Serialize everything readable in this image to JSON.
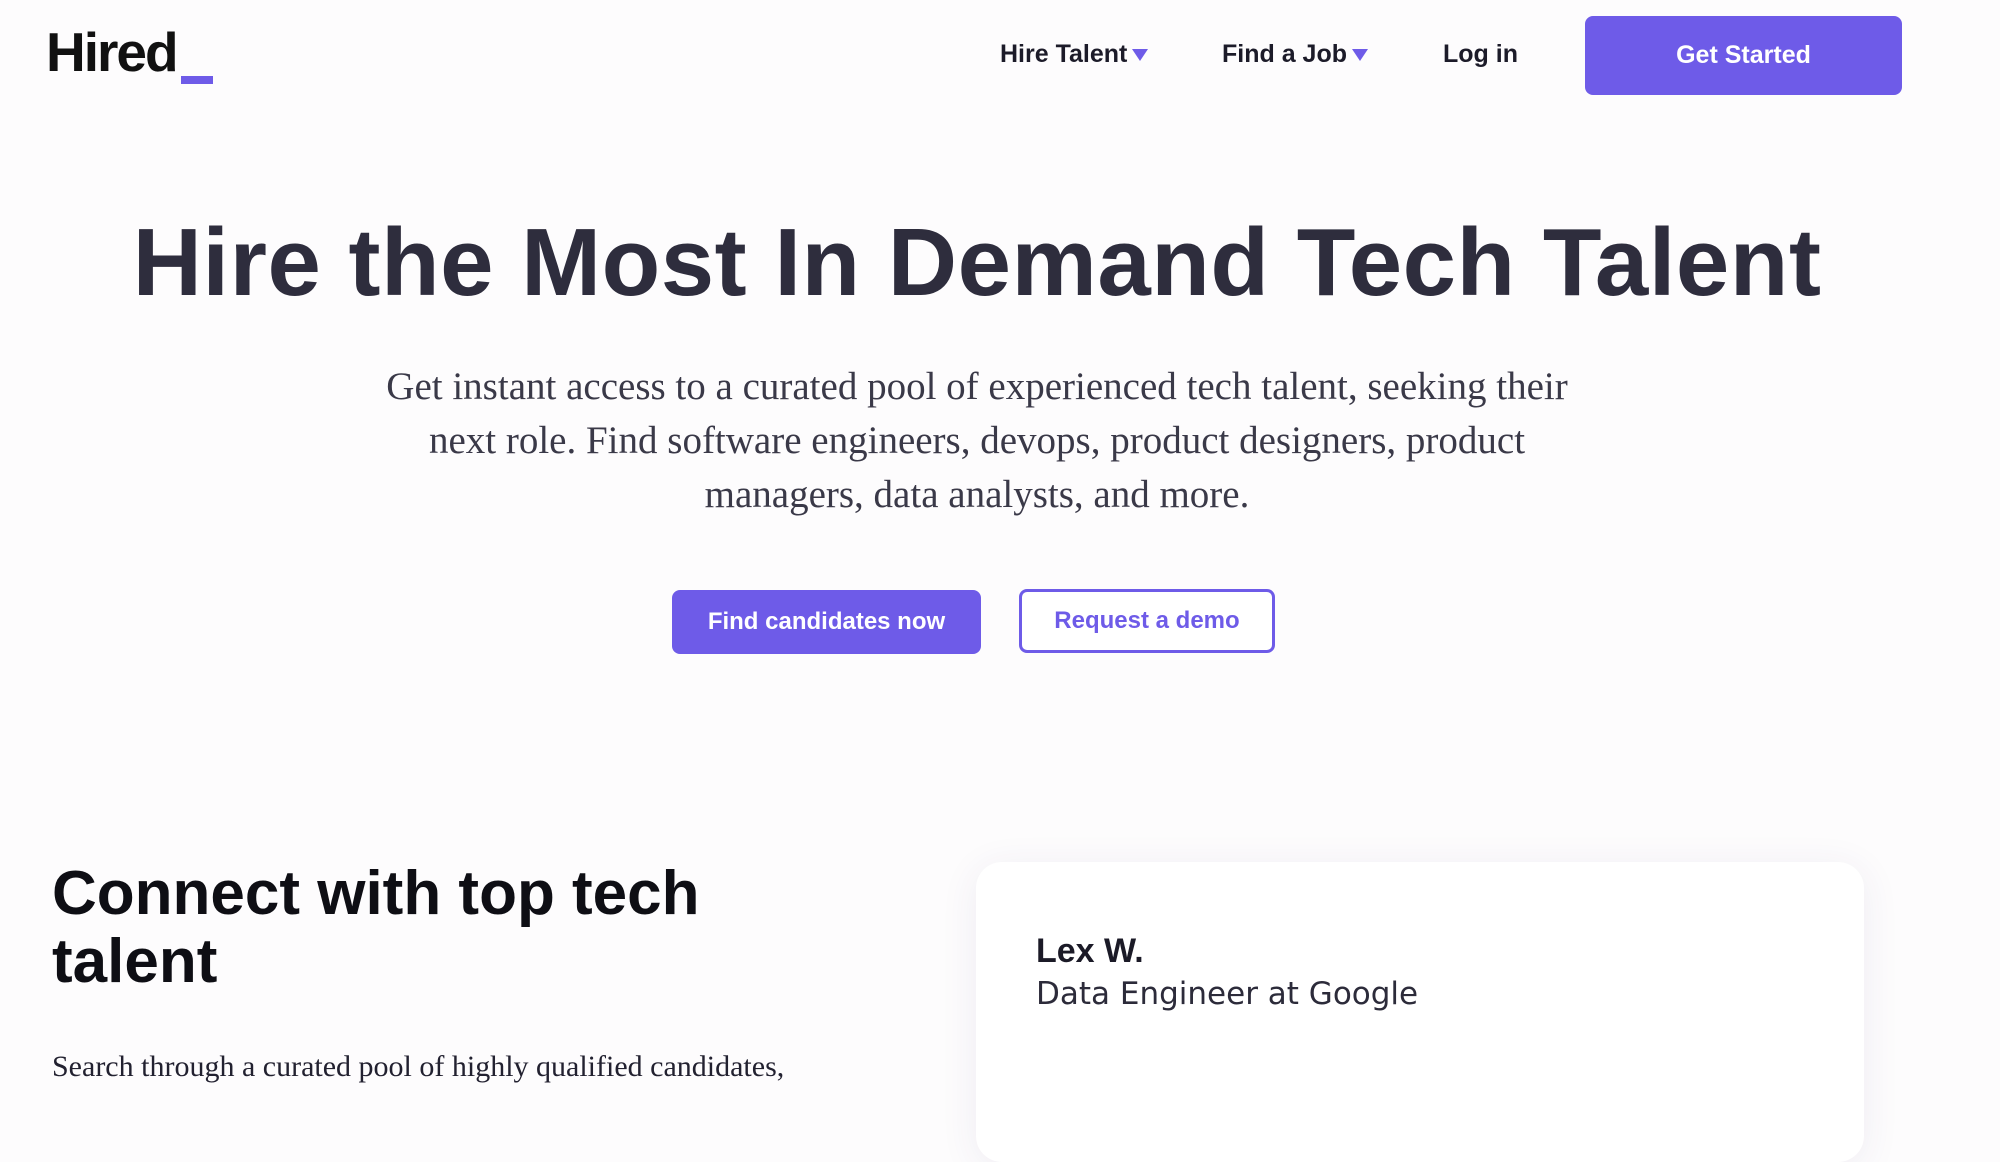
{
  "brand": {
    "logo_text": "Hired",
    "accent_color": "#6e5be8"
  },
  "nav": {
    "hire_talent": "Hire Talent",
    "find_job": "Find a Job",
    "login": "Log in",
    "cta": "Get Started"
  },
  "hero": {
    "title": "Hire the Most In Demand Tech Talent",
    "subtitle": "Get instant access to a curated pool of experienced tech talent, seeking their next role. Find software engineers, devops, product designers, product managers, data analysts, and more.",
    "primary_button": "Find candidates now",
    "secondary_button": "Request a demo"
  },
  "connect": {
    "title": "Connect with top tech talent",
    "text": "Search through a curated pool of highly qualified candidates,"
  },
  "candidate_card": {
    "name": "Lex W.",
    "role": "Data Engineer at Google"
  }
}
